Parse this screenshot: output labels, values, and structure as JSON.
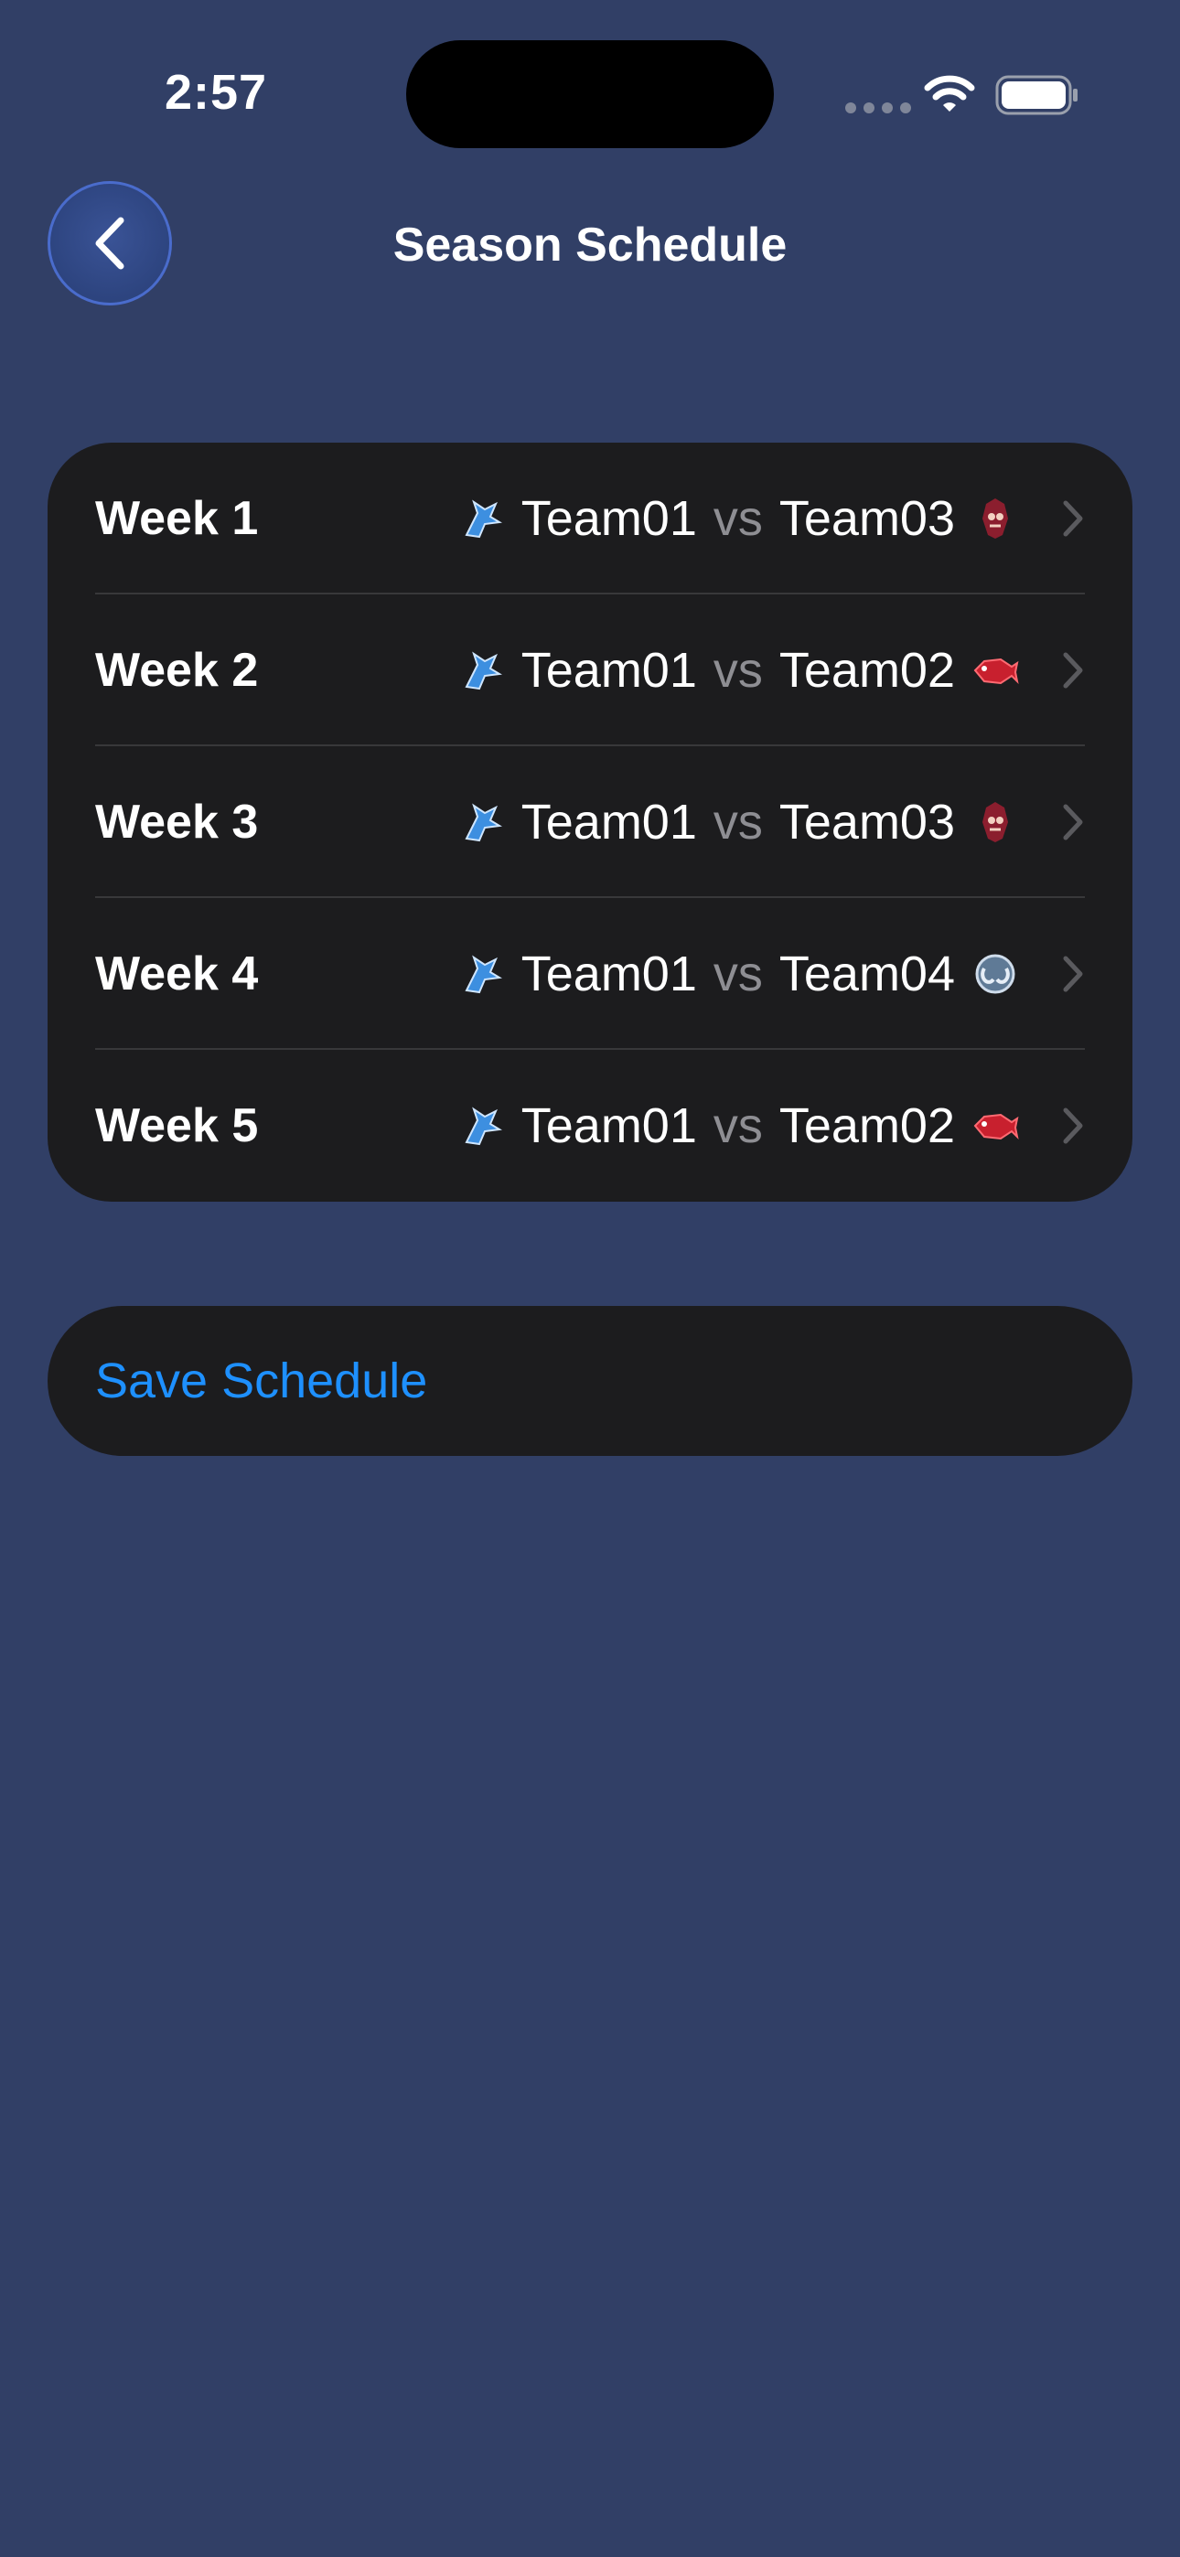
{
  "status_bar": {
    "time": "2:57"
  },
  "nav": {
    "title": "Season Schedule",
    "back_icon": "chevron-left-icon"
  },
  "schedule": {
    "vs_label": "vs",
    "weeks": [
      {
        "label": "Week 1",
        "home": "Team01",
        "away": "Team03",
        "home_logo": "blue-jay-icon",
        "away_logo": "maroon-mascot-icon"
      },
      {
        "label": "Week 2",
        "home": "Team01",
        "away": "Team02",
        "home_logo": "blue-jay-icon",
        "away_logo": "red-fish-icon"
      },
      {
        "label": "Week 3",
        "home": "Team01",
        "away": "Team03",
        "home_logo": "blue-jay-icon",
        "away_logo": "maroon-mascot-icon"
      },
      {
        "label": "Week 4",
        "home": "Team01",
        "away": "Team04",
        "home_logo": "blue-jay-icon",
        "away_logo": "gray-ram-icon"
      },
      {
        "label": "Week 5",
        "home": "Team01",
        "away": "Team02",
        "home_logo": "blue-jay-icon",
        "away_logo": "red-fish-icon"
      }
    ]
  },
  "actions": {
    "save_label": "Save Schedule"
  },
  "colors": {
    "background": "#313f66",
    "card": "#1c1c1e",
    "accent": "#1e90ff",
    "secondary_text": "#8e8e93"
  }
}
